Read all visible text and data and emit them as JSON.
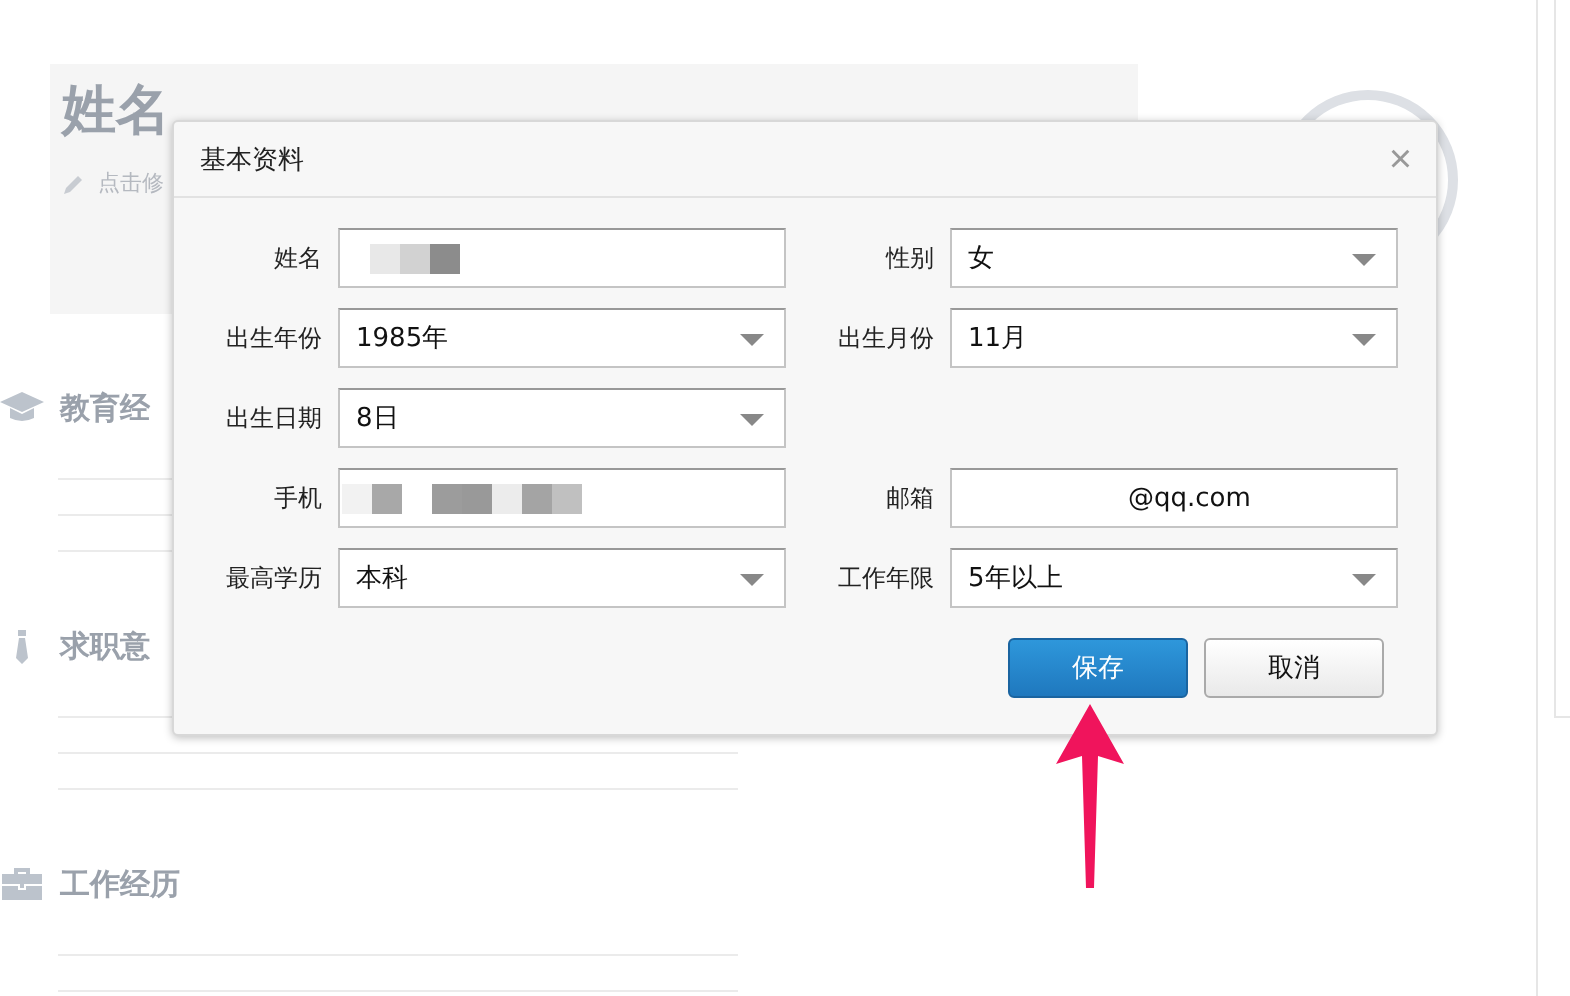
{
  "profile": {
    "name": "姓名",
    "edit_hint": "点击修"
  },
  "sections": [
    {
      "kind": "education",
      "title": "教育经"
    },
    {
      "kind": "job",
      "title": "求职意"
    },
    {
      "kind": "work",
      "title": "工作经历"
    }
  ],
  "dialog": {
    "title": "基本资料",
    "close": "×",
    "rows": [
      [
        {
          "label": "姓名",
          "kind": "text",
          "masked": true
        },
        {
          "label": "性别",
          "kind": "select",
          "value": "女"
        }
      ],
      [
        {
          "label": "出生年份",
          "kind": "select",
          "value": "1985年"
        },
        {
          "label": "出生月份",
          "kind": "select",
          "value": "11月"
        }
      ],
      [
        {
          "label": "出生日期",
          "kind": "select",
          "value": "8日"
        }
      ],
      [
        {
          "label": "手机",
          "kind": "text",
          "masked": true
        },
        {
          "label": "邮箱",
          "kind": "text",
          "value": "@qq.com"
        }
      ],
      [
        {
          "label": "最高学历",
          "kind": "select",
          "value": "本科"
        },
        {
          "label": "工作年限",
          "kind": "select",
          "value": "5年以上"
        }
      ]
    ],
    "buttons": [
      {
        "label": "保存",
        "kind": "primary"
      },
      {
        "label": "取消",
        "kind": "secondary"
      }
    ]
  }
}
